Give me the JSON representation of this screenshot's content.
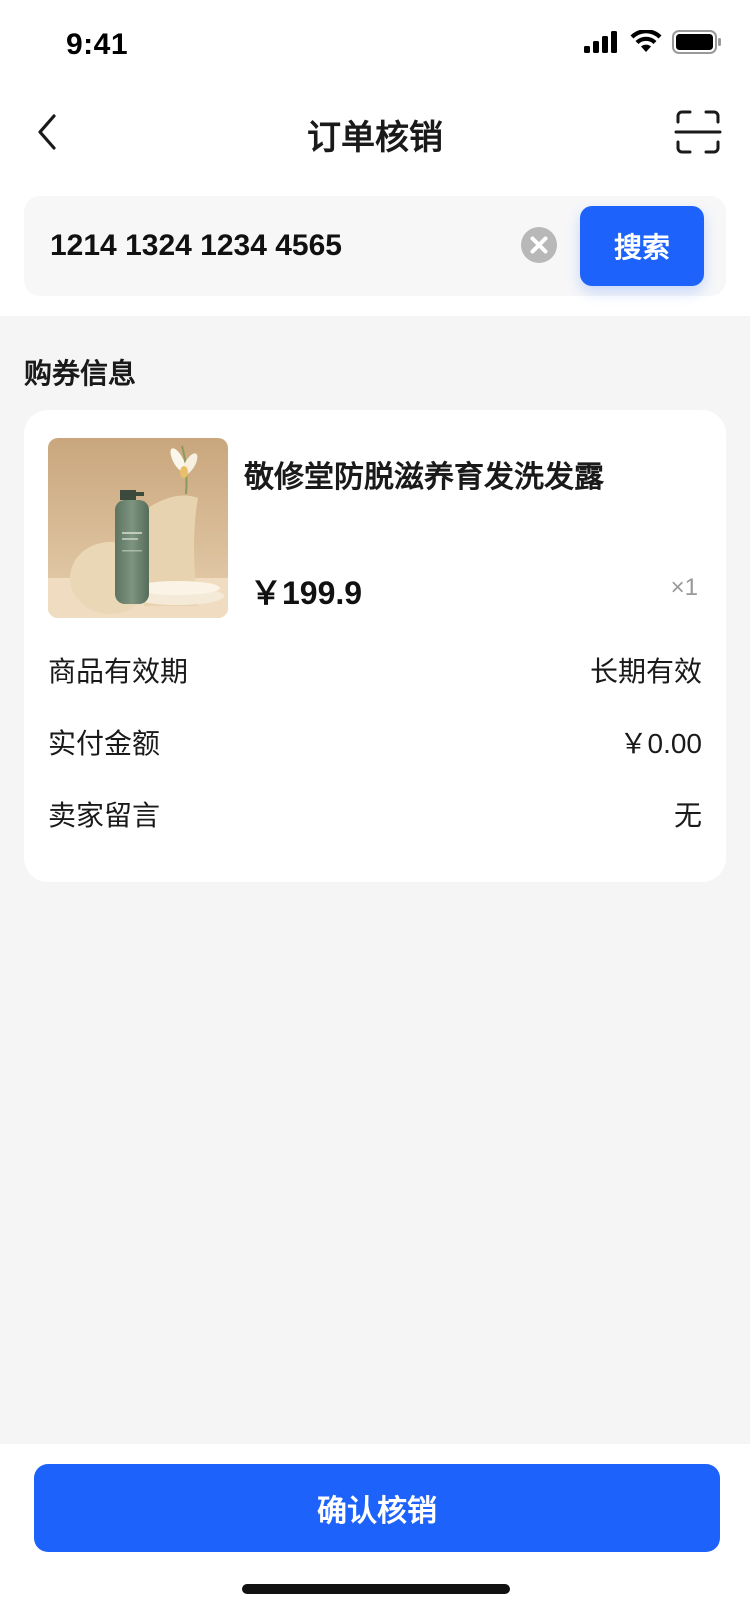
{
  "status_bar": {
    "time": "9:41",
    "icons": [
      "signal-icon",
      "wifi-icon",
      "battery-icon"
    ]
  },
  "nav": {
    "title": "订单核销",
    "back_icon": "chevron-left-icon",
    "scan_icon": "scan-icon"
  },
  "search": {
    "value": "1214 1324 1234 4565",
    "placeholder": "",
    "clear_icon": "clear-circle-icon",
    "button_label": "搜索"
  },
  "coupon": {
    "section_title": "购券信息",
    "product": {
      "name": "敬修堂防脱滋养育发洗发露",
      "price": "￥199.9",
      "quantity": "×1"
    },
    "details": [
      {
        "label": "商品有效期",
        "value": "长期有效"
      },
      {
        "label": "实付金额",
        "value": "￥0.00"
      },
      {
        "label": "卖家留言",
        "value": "无"
      }
    ]
  },
  "footer": {
    "confirm_label": "确认核销"
  },
  "colors": {
    "primary": "#1d63fb",
    "page_bg": "#f5f5f5",
    "card_bg": "#ffffff"
  }
}
